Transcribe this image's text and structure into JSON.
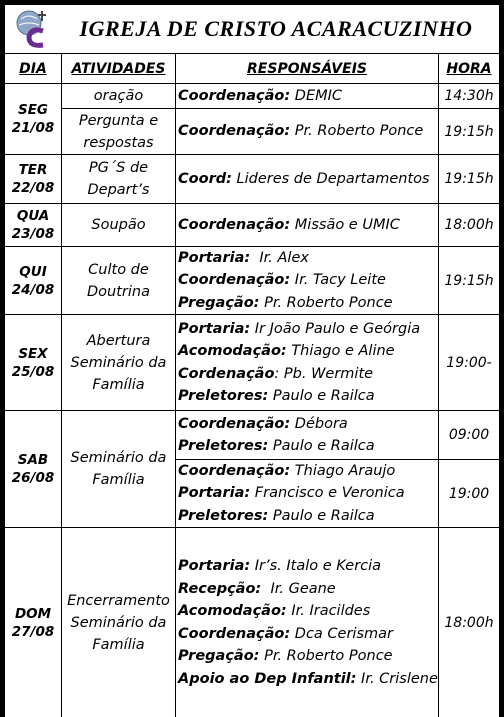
{
  "title": "IGREJA DE CRISTO ACARACUZINHO",
  "headers": {
    "dia": "DIA",
    "atividades": "ATIVIDADES",
    "responsaveis": "RESPONSÁVEIS",
    "hora": "HORA"
  },
  "rows": [
    {
      "day": "SEG",
      "date": "21/08",
      "items": [
        {
          "activity": [
            "oração"
          ],
          "resp": [
            {
              "label": "Coordenação:",
              "value": " DEMIC"
            }
          ],
          "time": "14:30h"
        },
        {
          "activity": [
            "Pergunta e",
            "respostas"
          ],
          "resp": [
            {
              "label": "Coordenação:",
              "value": " Pr. Roberto Ponce"
            }
          ],
          "time": "19:15h"
        }
      ]
    },
    {
      "day": "TER",
      "date": "22/08",
      "items": [
        {
          "activity": [
            "PG´S de",
            "Depart’s"
          ],
          "resp": [
            {
              "label": "Coord:",
              "value": " Lideres de Departamentos"
            }
          ],
          "time": "19:15h"
        }
      ]
    },
    {
      "day": "QUA",
      "date": "23/08",
      "items": [
        {
          "activity": [
            "Soupão"
          ],
          "resp": [
            {
              "label": "Coordenação:",
              "value": " Missão e UMIC"
            }
          ],
          "time": "18:00h"
        }
      ]
    },
    {
      "day": "QUI",
      "date": "24/08",
      "items": [
        {
          "activity": [
            "Culto de",
            "Doutrina"
          ],
          "resp": [
            {
              "label": "Portaria:",
              "value": "  Ir. Alex"
            },
            {
              "label": "Coordenação:",
              "value": " Ir. Tacy Leite"
            },
            {
              "label": "Pregação:",
              "value": " Pr. Roberto Ponce"
            }
          ],
          "time": "19:15h"
        }
      ]
    },
    {
      "day": "SEX",
      "date": "25/08",
      "items": [
        {
          "activity": [
            "Abertura",
            "Seminário da",
            "Família"
          ],
          "resp": [
            {
              "label": "Portaria:",
              "value": " Ir João Paulo e Geórgia"
            },
            {
              "label": "Acomodação:",
              "value": " Thiago e Aline"
            },
            {
              "label": "Cordenação",
              "value": ": Pb. Wermite"
            },
            {
              "label": "Preletores:",
              "value": " Paulo e Railca"
            }
          ],
          "time": "19:00-"
        }
      ]
    },
    {
      "day": "SAB",
      "date": "26/08",
      "items": [
        {
          "activity": [
            "Seminário da",
            "Família"
          ],
          "resp": [
            {
              "label": "Coordenação:",
              "value": " Débora"
            },
            {
              "label": "Preletores:",
              "value": " Paulo e Railca"
            }
          ],
          "time": "09:00"
        },
        {
          "activity": [],
          "resp": [
            {
              "label": "Coordenação:",
              "value": " Thiago Araujo"
            },
            {
              "label": "Portaria:",
              "value": " Francisco e Veronica"
            },
            {
              "label": "Preletores:",
              "value": " Paulo e Railca"
            }
          ],
          "time": "19:00"
        }
      ]
    },
    {
      "day": "DOM",
      "date": "27/08",
      "items": [
        {
          "activity": [
            "Encerramento",
            "Seminário da",
            "Família"
          ],
          "resp": [
            {
              "label": "Portaria:",
              "value": " Ir’s. Italo e Kercia"
            },
            {
              "label": "Recepção:",
              "value": "  Ir. Geane"
            },
            {
              "label": "Acomodação:",
              "value": " Ir. Iracildes"
            },
            {
              "label": "Coordenação:",
              "value": " Dca Cerismar"
            },
            {
              "label": "Pregação:",
              "value": " Pr. Roberto Ponce"
            },
            {
              "label": "Apoio ao Dep Infantil:",
              "value": " Ir. Crislene"
            }
          ],
          "time": "18:00h"
        }
      ]
    }
  ]
}
